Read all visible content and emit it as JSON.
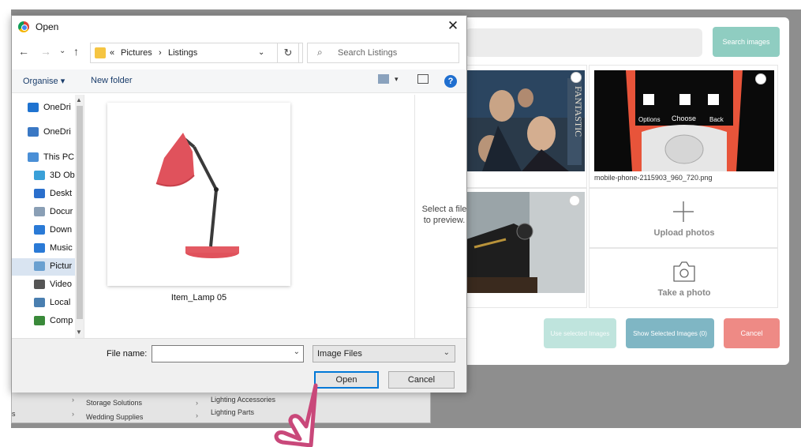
{
  "background": {
    "menu": {
      "col1": [
        "Storage Solutions",
        "Wedding Supplies"
      ],
      "col2": [
        "Lighting Accessories",
        "Lighting Parts"
      ],
      "partial": "s"
    }
  },
  "modal": {
    "search_button": "Search images",
    "tiles": [
      {
        "caption": ""
      },
      {
        "caption": "mobile-phone-2115903_960_720.png"
      },
      {
        "caption": ""
      }
    ],
    "phone_keys": [
      "Options",
      "Choose",
      "Back"
    ],
    "upload_label": "Upload photos",
    "take_photo_label": "Take a photo",
    "use_selected": "Use selected Images",
    "show_selected": "Show Selected Images (0)",
    "cancel": "Cancel",
    "colors": {
      "search": "#8fcdc1",
      "use": "#bfe4dd",
      "show": "#7fb6c4",
      "cancel": "#ee8a85"
    }
  },
  "dialog": {
    "title": "Open",
    "breadcrumb": [
      "«",
      "Pictures",
      "›",
      "Listings"
    ],
    "search_placeholder": "Search Listings",
    "toolbar": {
      "organise": "Organise ▾",
      "new_folder": "New folder"
    },
    "sidebar": [
      {
        "label": "OneDri",
        "icon": "cloud-icon",
        "color": "#1f73d0"
      },
      {
        "label": "OneDri",
        "icon": "onedrive-window-icon",
        "color": "#3a78c4"
      },
      {
        "label": "This PC",
        "icon": "monitor-icon",
        "color": "#4a8fd6"
      },
      {
        "label": "3D Ob",
        "icon": "cube-icon",
        "color": "#3aa0d8"
      },
      {
        "label": "Deskt",
        "icon": "desktop-icon",
        "color": "#2a6fcc"
      },
      {
        "label": "Docur",
        "icon": "document-icon",
        "color": "#8a9fb5"
      },
      {
        "label": "Down",
        "icon": "download-arrow-icon",
        "color": "#2a7ad6"
      },
      {
        "label": "Music",
        "icon": "music-note-icon",
        "color": "#2a7ad6"
      },
      {
        "label": "Pictur",
        "icon": "pictures-icon",
        "color": "#6aa0d0"
      },
      {
        "label": "Video",
        "icon": "video-icon",
        "color": "#555"
      },
      {
        "label": "Local",
        "icon": "local-disk-icon",
        "color": "#4a7fb0"
      },
      {
        "label": "Comp",
        "icon": "network-drive-icon",
        "color": "#3a8a3a"
      }
    ],
    "selected_sidebar_index": 8,
    "file": {
      "name": "Item_Lamp 05"
    },
    "preview_text": "Select a file to preview.",
    "file_name_label": "File name:",
    "file_name_value": "",
    "file_type": "Image Files",
    "open_button": "Open",
    "cancel_button": "Cancel"
  }
}
